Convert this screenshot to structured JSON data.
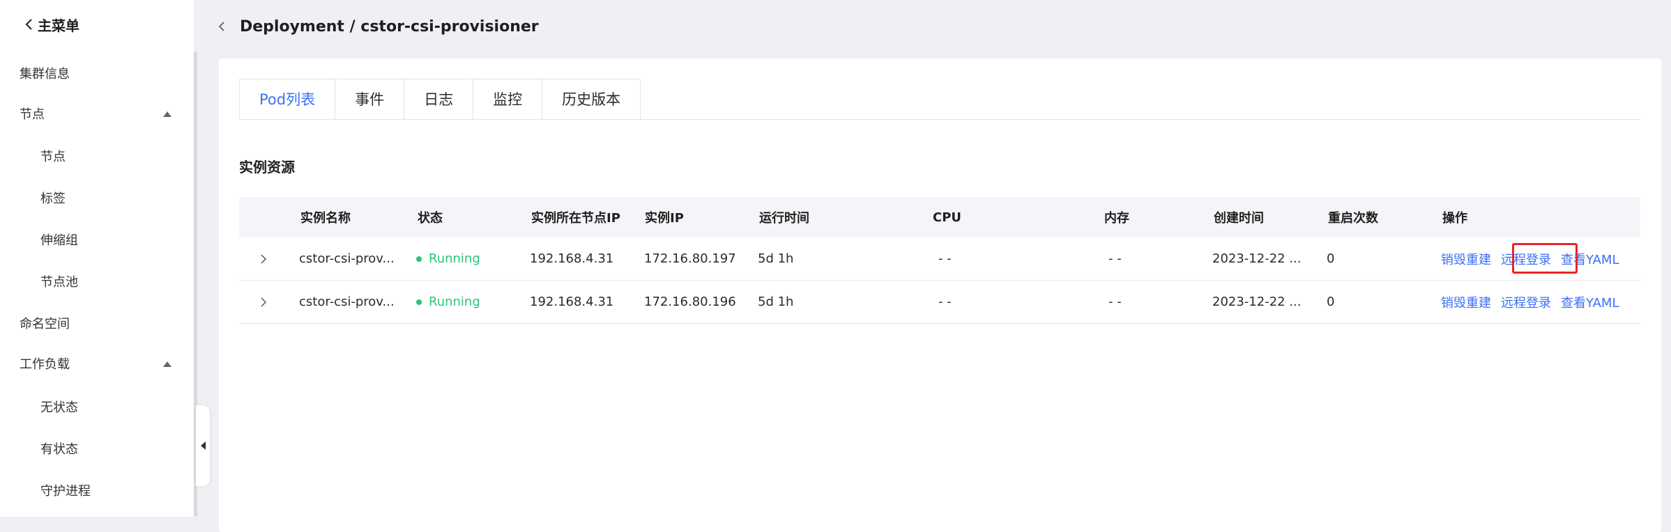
{
  "sidebar": {
    "back_label": "主菜单",
    "items": [
      {
        "label": "集群信息"
      },
      {
        "label": "节点"
      },
      {
        "label": "节点"
      },
      {
        "label": "标签"
      },
      {
        "label": "伸缩组"
      },
      {
        "label": "节点池"
      },
      {
        "label": "命名空间"
      },
      {
        "label": "工作负载"
      },
      {
        "label": "无状态"
      },
      {
        "label": "有状态"
      },
      {
        "label": "守护进程"
      }
    ]
  },
  "header": {
    "title": "Deployment / cstor-csi-provisioner"
  },
  "tabs": [
    {
      "label": "Pod列表",
      "active": true
    },
    {
      "label": "事件"
    },
    {
      "label": "日志"
    },
    {
      "label": "监控"
    },
    {
      "label": "历史版本"
    }
  ],
  "section_title": "实例资源",
  "table": {
    "columns": [
      "实例名称",
      "状态",
      "实例所在节点IP",
      "实例IP",
      "运行时间",
      "CPU",
      "内存",
      "创建时间",
      "重启次数",
      "操作"
    ],
    "rows": [
      {
        "name": "cstor-csi-prov...",
        "status": "Running",
        "node_ip": "192.168.4.31",
        "pod_ip": "172.16.80.197",
        "uptime": "5d 1h",
        "cpu": "- -",
        "memory": "- -",
        "created": "2023-12-22 ...",
        "restarts": "0",
        "actions": [
          "销毁重建",
          "远程登录",
          "查看YAML"
        ]
      },
      {
        "name": "cstor-csi-prov...",
        "status": "Running",
        "node_ip": "192.168.4.31",
        "pod_ip": "172.16.80.196",
        "uptime": "5d 1h",
        "cpu": "- -",
        "memory": "- -",
        "created": "2023-12-22 ...",
        "restarts": "0",
        "actions": [
          "销毁重建",
          "远程登录",
          "查看YAML"
        ]
      }
    ]
  },
  "colors": {
    "accent": "#3b6ff5",
    "running": "#2ec27e",
    "highlight": "#e52727"
  }
}
